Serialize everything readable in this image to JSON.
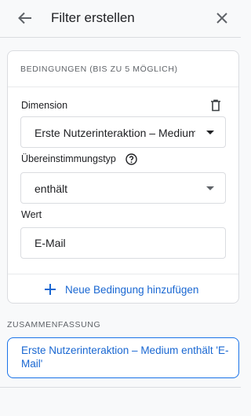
{
  "header": {
    "title": "Filter erstellen",
    "back_icon": "arrow-back-icon",
    "close_icon": "close-icon"
  },
  "conditions": {
    "heading": "BEDINGUNGEN (BIS ZU 5 MÖGLICH)",
    "dimension_label": "Dimension",
    "dimension_value": "Erste Nutzerinteraktion – Medium",
    "delete_icon": "trash-icon",
    "match_type_label": "Übereinstimmungstyp",
    "match_type_help_icon": "help-icon",
    "match_type_value": "enthält",
    "value_label": "Wert",
    "value_input": "E-Mail",
    "add_condition_label": "Neue Bedingung hinzufügen"
  },
  "summary": {
    "heading": "ZUSAMMENFASSUNG",
    "text": "Erste Nutzerinteraktion – Medium enthält 'E-Mail'"
  },
  "colors": {
    "accent": "#1a73e8",
    "link_text": "#1967d2",
    "border": "#dadce0",
    "background": "#f8f9fa"
  }
}
